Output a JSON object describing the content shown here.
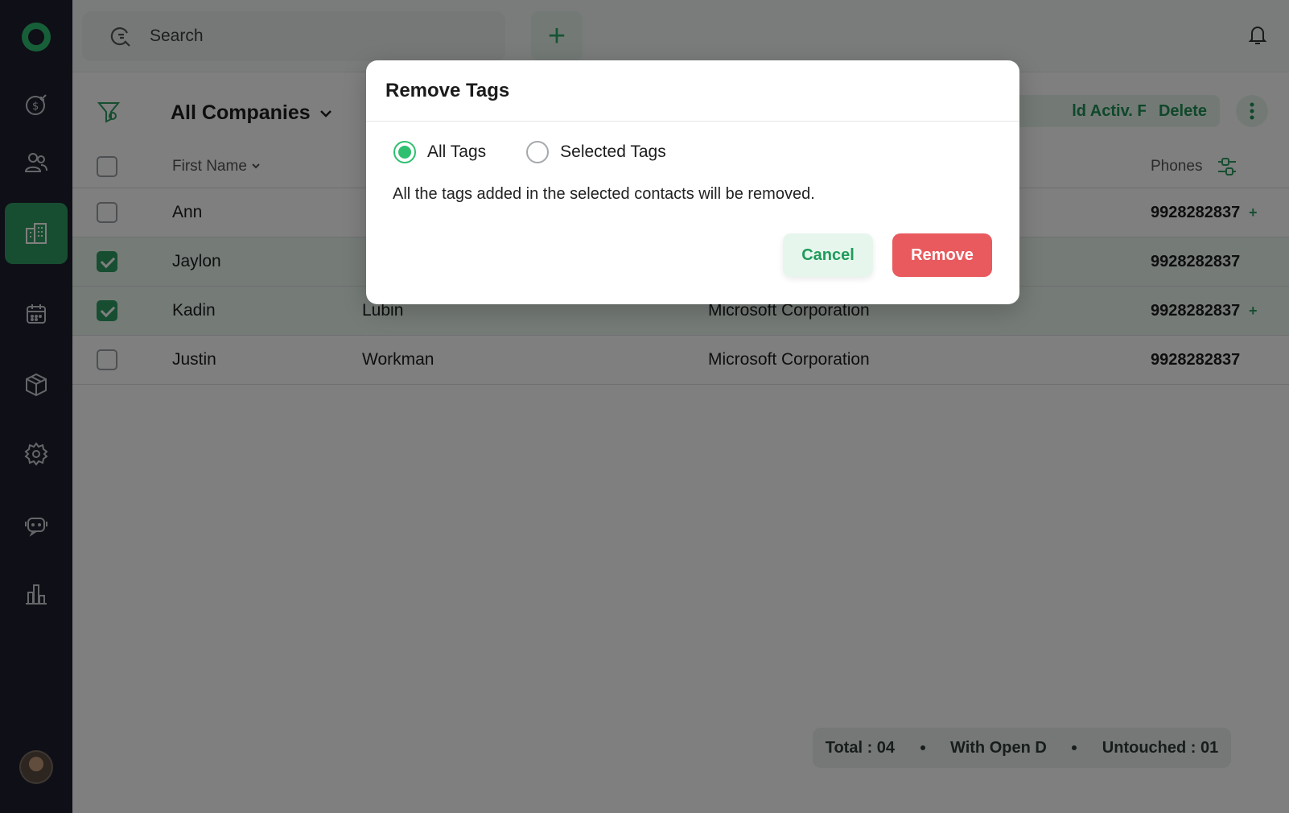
{
  "sidebar": {
    "items": [
      {
        "name": "deals",
        "icon": "money-icon"
      },
      {
        "name": "contacts",
        "icon": "people-icon"
      },
      {
        "name": "companies",
        "icon": "building-icon",
        "active": true
      },
      {
        "name": "calendar",
        "icon": "calendar-icon"
      },
      {
        "name": "products",
        "icon": "box-icon"
      },
      {
        "name": "settings",
        "icon": "gear-icon"
      },
      {
        "name": "chat",
        "icon": "chat-icon"
      },
      {
        "name": "reports",
        "icon": "bar-chart-icon"
      }
    ]
  },
  "topbar": {
    "search_placeholder": "Search",
    "add_label": "+"
  },
  "main": {
    "view_title": "All Companies",
    "toolbar": {
      "active_field_label": "ld Activ. Field",
      "delete_label": "Delete"
    },
    "table": {
      "headers": {
        "first_name": "First Name",
        "phones": "Phones"
      },
      "rows": [
        {
          "first": "Ann",
          "last": "",
          "company": "",
          "phone": "9928282837",
          "plus": "+",
          "checked": false
        },
        {
          "first": "Jaylon",
          "last": "",
          "company": "",
          "phone": "9928282837",
          "plus": "",
          "checked": true
        },
        {
          "first": "Kadin",
          "last": "Lubin",
          "company": "Microsoft Corporation",
          "phone": "9928282837",
          "plus": "+",
          "checked": true
        },
        {
          "first": "Justin",
          "last": "Workman",
          "company": "Microsoft Corporation",
          "phone": "9928282837",
          "plus": "",
          "checked": false
        }
      ]
    },
    "stats": {
      "total": "Total : 04",
      "open": "With Open D",
      "untouched": "Untouched : 01"
    }
  },
  "modal": {
    "title": "Remove Tags",
    "option_all": "All Tags",
    "option_selected": "Selected Tags",
    "message": "All the tags added in the selected contacts will be removed.",
    "cancel_label": "Cancel",
    "remove_label": "Remove"
  },
  "colors": {
    "accent": "#2fbf71",
    "sidebar_bg": "#1f1f2e",
    "danger": "#e85a5e"
  }
}
